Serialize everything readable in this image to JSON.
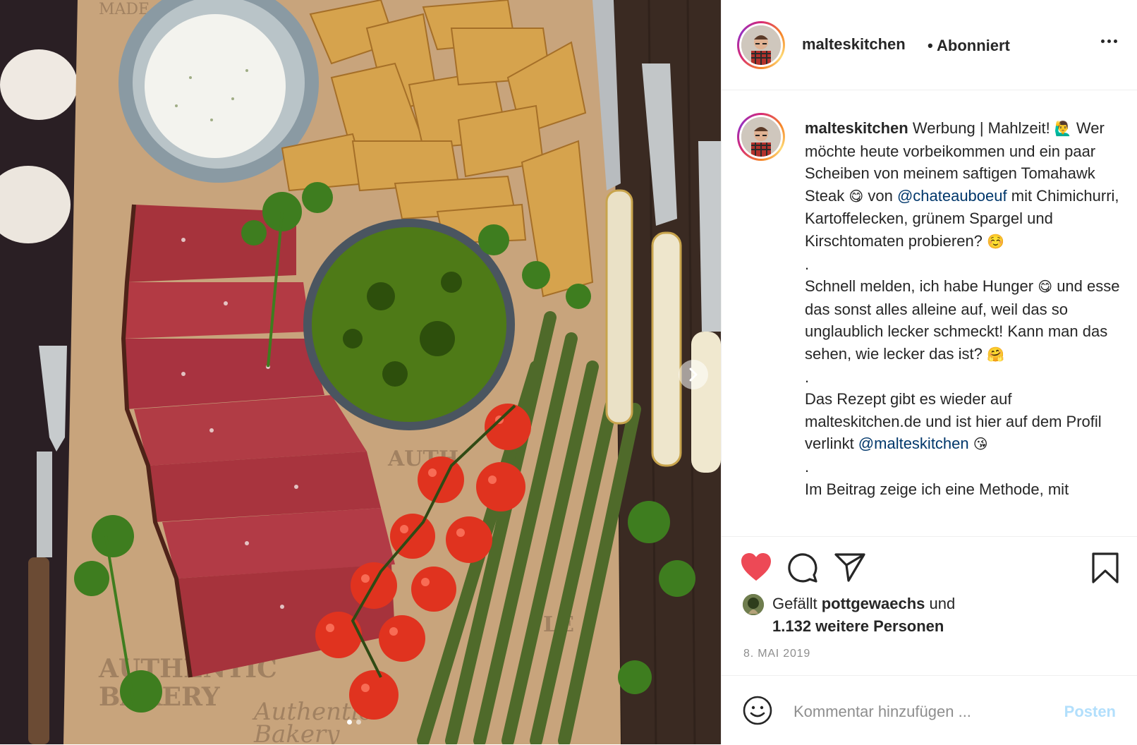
{
  "post": {
    "username": "malteskitchen",
    "follow_separator": "•",
    "follow_status": "Abonniert",
    "carousel": {
      "slides": 2,
      "active_slide": 1
    }
  },
  "caption": {
    "username": "malteskitchen",
    "p1_a": "Werbung | Mahlzeit! ",
    "p1_emoji1": "🙋‍♂️",
    "p1_b": " Wer möchte heute vorbeikommen und ein paar Scheiben von meinem saftigen Tomahawk Steak ",
    "p1_emoji2": "😋",
    "p1_c": " von ",
    "mention1": "@chateauboeuf",
    "p1_d": " mit Chimichurri, Kartoffelecken, grünem Spargel und Kirschtomaten probieren? ",
    "p1_emoji3": "☺️",
    "dot": ".",
    "p2_a": "Schnell melden, ich habe Hunger ",
    "p2_emoji1": "😋",
    "p2_b": " und esse das sonst alles alleine auf, weil das so unglaublich lecker schmeckt! Kann man das sehen, wie lecker das ist? ",
    "p2_emoji2": "🤗",
    "p3_a": "Das Rezept gibt es wieder auf malteskitchen.de und ist hier auf dem Profil verlinkt ",
    "mention2": "@malteskitchen",
    "p3_emoji": "😘",
    "p4_partial": "Im Beitrag zeige ich eine Methode, mit"
  },
  "likes": {
    "prefix": "Gefällt ",
    "user": "pottgewaechs",
    "mid": " und",
    "others": "1.132 weitere Personen"
  },
  "date": "8. MAI 2019",
  "comment": {
    "placeholder": "Kommentar hinzufügen ...",
    "post_label": "Posten"
  },
  "icons": {
    "like": "heart-filled-icon",
    "comment": "comment-icon",
    "share": "paper-plane-icon",
    "save": "bookmark-icon",
    "emoji": "smiley-icon",
    "more": "more-dots-icon",
    "next": "chevron-right-icon"
  },
  "colors": {
    "heart": "#ed4956",
    "link": "#00376b",
    "post_disabled": "#b2dffc",
    "muted": "#8e8e8e"
  }
}
